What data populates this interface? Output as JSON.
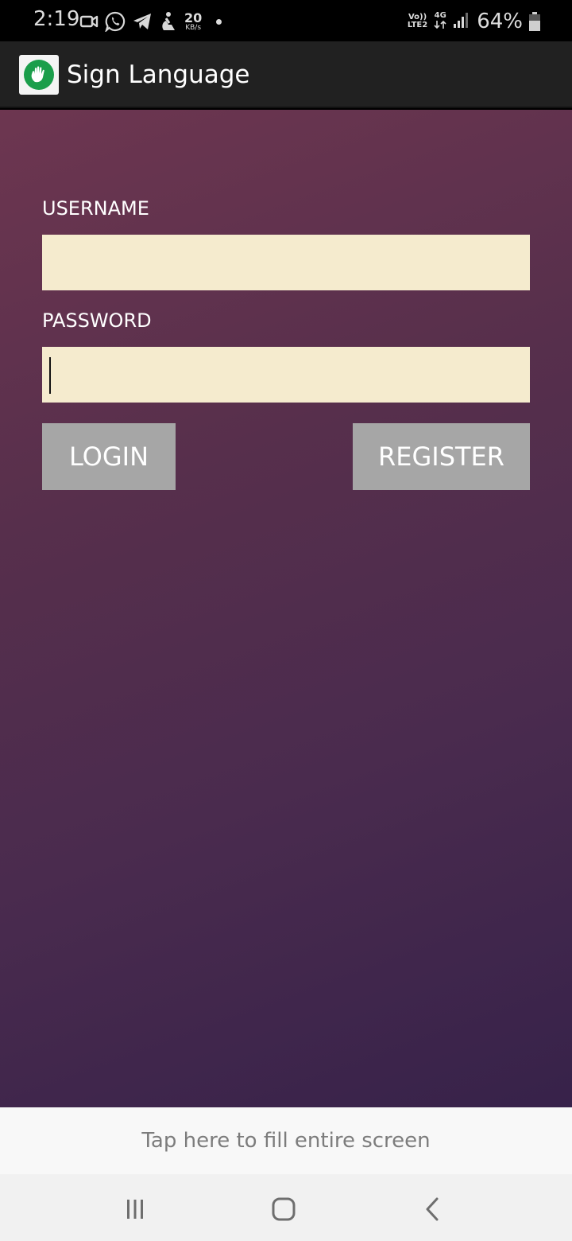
{
  "status_bar": {
    "time": "2:19",
    "net_speed_value": "20",
    "net_speed_unit": "KB/s",
    "volte_top": "Vo))",
    "volte_bottom": "LTE2",
    "network_type": "4G",
    "battery_percent": "64%",
    "icons": [
      "video-call-icon",
      "whatsapp-icon",
      "telegram-icon",
      "accessibility-icon",
      "dot-icon",
      "signal-icon",
      "battery-icon"
    ]
  },
  "app_bar": {
    "title": "Sign Language",
    "logo_icon": "hand-icon",
    "logo_color": "#1b9e4b"
  },
  "form": {
    "username_label": "USERNAME",
    "username_value": "",
    "password_label": "PASSWORD",
    "password_value": "",
    "login_label": "LOGIN",
    "register_label": "REGISTER"
  },
  "banner": {
    "text": "Tap here to fill entire screen"
  },
  "nav_bar": {
    "icons": [
      "recents-icon",
      "home-icon",
      "back-icon"
    ]
  },
  "colors": {
    "background_top": "#6d3650",
    "background_bottom": "#37224a",
    "input_fill": "#f5ebce",
    "button_fill": "#a6a6a6"
  }
}
